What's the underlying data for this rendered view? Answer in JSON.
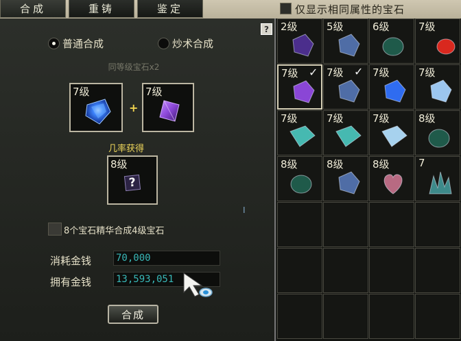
{
  "tabs": [
    {
      "label": "合成"
    },
    {
      "label": "重铸"
    },
    {
      "label": "鉴定"
    }
  ],
  "filter": {
    "label": "仅显示相同属性的宝石",
    "checked": false
  },
  "help_label": "?",
  "modes": [
    {
      "label": "普通合成",
      "selected": true
    },
    {
      "label": "炒术合成",
      "selected": false
    }
  ],
  "same_level_note": "同等级宝石x2",
  "inputs": [
    {
      "level": "7级",
      "gem": "blue-sapphire"
    },
    {
      "level": "7级",
      "gem": "purple-amethyst"
    }
  ],
  "plus_sign": "+",
  "probability_label": "几率获得",
  "output": {
    "level": "8级",
    "unknown": "?"
  },
  "essence_option": {
    "label": "8个宝石精华合成4级宝石",
    "checked": false
  },
  "cost": {
    "label": "消耗金钱",
    "value": "70,000"
  },
  "owned": {
    "label": "拥有金钱",
    "value": "13,593,051"
  },
  "compose_button": "合成",
  "inventory": [
    {
      "level": "2级",
      "gem": "purple-flat",
      "checked": false,
      "selected": false
    },
    {
      "level": "5级",
      "gem": "blue-crystal",
      "checked": false,
      "selected": false
    },
    {
      "level": "6级",
      "gem": "green-flat",
      "checked": false,
      "selected": false
    },
    {
      "level": "7级",
      "gem": "red-oval",
      "checked": false,
      "selected": false
    },
    {
      "level": "7级",
      "gem": "purple-amethyst",
      "checked": true,
      "selected": true
    },
    {
      "level": "7级",
      "gem": "blue-crystal",
      "checked": true,
      "selected": false
    },
    {
      "level": "7级",
      "gem": "blue-sapphire",
      "checked": false,
      "selected": false
    },
    {
      "level": "7级",
      "gem": "ice-crystal",
      "checked": false,
      "selected": false
    },
    {
      "level": "7级",
      "gem": "cyan-emerald",
      "checked": false,
      "selected": false
    },
    {
      "level": "7级",
      "gem": "cyan-emerald",
      "checked": false,
      "selected": false
    },
    {
      "level": "7级",
      "gem": "ice-cube",
      "checked": false,
      "selected": false
    },
    {
      "level": "8级",
      "gem": "green-flat",
      "checked": false,
      "selected": false
    },
    {
      "level": "8级",
      "gem": "green-flat",
      "checked": false,
      "selected": false
    },
    {
      "level": "8级",
      "gem": "blue-crystal",
      "checked": false,
      "selected": false
    },
    {
      "level": "8级",
      "gem": "pink-heart",
      "checked": false,
      "selected": false
    },
    {
      "level": "7",
      "gem": "teal-cluster",
      "checked": false,
      "selected": false
    }
  ],
  "gem_colors": {
    "blue-sapphire": "#2f6cf0",
    "purple-amethyst": "#8a46d6",
    "purple-flat": "#4b2e8c",
    "blue-crystal": "#4f6da6",
    "green-flat": "#1f5a4a",
    "red-oval": "#d9281e",
    "ice-crystal": "#9cc6ef",
    "cyan-emerald": "#46b9b1",
    "ice-cube": "#a7d2ee",
    "pink-heart": "#b86a82",
    "teal-cluster": "#3d8a8a"
  }
}
